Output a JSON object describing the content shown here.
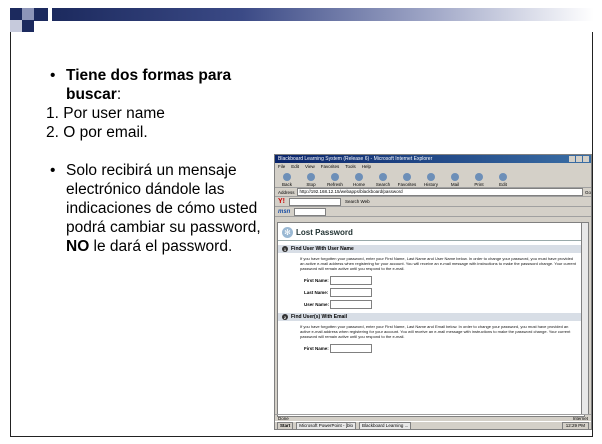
{
  "slide": {
    "bullet1_bold": "Tiene dos formas para buscar",
    "bullet1_rest": ":",
    "item1": "1. Por user name",
    "item2": "2. O por email.",
    "bullet2_pre": "Solo recibirá un mensaje electrónico dándole las indicaciones de cómo usted podrá cambiar su password, ",
    "bullet2_bold": "NO",
    "bullet2_post": " le dará el password."
  },
  "browser": {
    "title": "Blackboard Learning System (Release 6) - Microsoft Internet Explorer",
    "menu": [
      "File",
      "Edit",
      "View",
      "Favorites",
      "Tools",
      "Help"
    ],
    "toolbar": [
      "Back",
      "Stop",
      "Refresh",
      "Home",
      "Search",
      "Favorites",
      "History",
      "Mail",
      "Print",
      "Edit"
    ],
    "address_label": "Address",
    "address": "http://192.168.12.15/webapps/blackboard/password",
    "go": "Go",
    "yahoo_logo": "Y!",
    "search_web": "Search Web",
    "msn_logo": "msn",
    "page": {
      "title": "Lost Password",
      "section1": "Find User With User Name",
      "section1_text": "If you have forgotten your password, enter your First Name, Last Name and User Name below. In order to change your password, you must have provided an active e-mail address when registering for your account. You will receive an e-mail message with instructions to make the password change. Your current password will remain active until you respond to the e-mail.",
      "first_name": "First Name:",
      "last_name": "Last Name:",
      "user_name": "User Name:",
      "section2": "Find User(s) With Email",
      "section2_text": "If you have forgotten your password, enter your First Name, Last Name and Email below. In order to change your password, you must have provided an active e-mail address when registering for your account. You will receive an e-mail message with instructions to make the password change. Your current password will remain active until you respond to the e-mail.",
      "first_name2": "First Name:"
    },
    "status_left": "Done",
    "status_right": "Internet",
    "taskbar": {
      "start": "Start",
      "task1": "Microsoft PowerPoint - [blo",
      "task2": "Blackboard Learning ...",
      "clock": "12:29 PM"
    }
  },
  "colors": {
    "accent": "#1c2a5e"
  }
}
